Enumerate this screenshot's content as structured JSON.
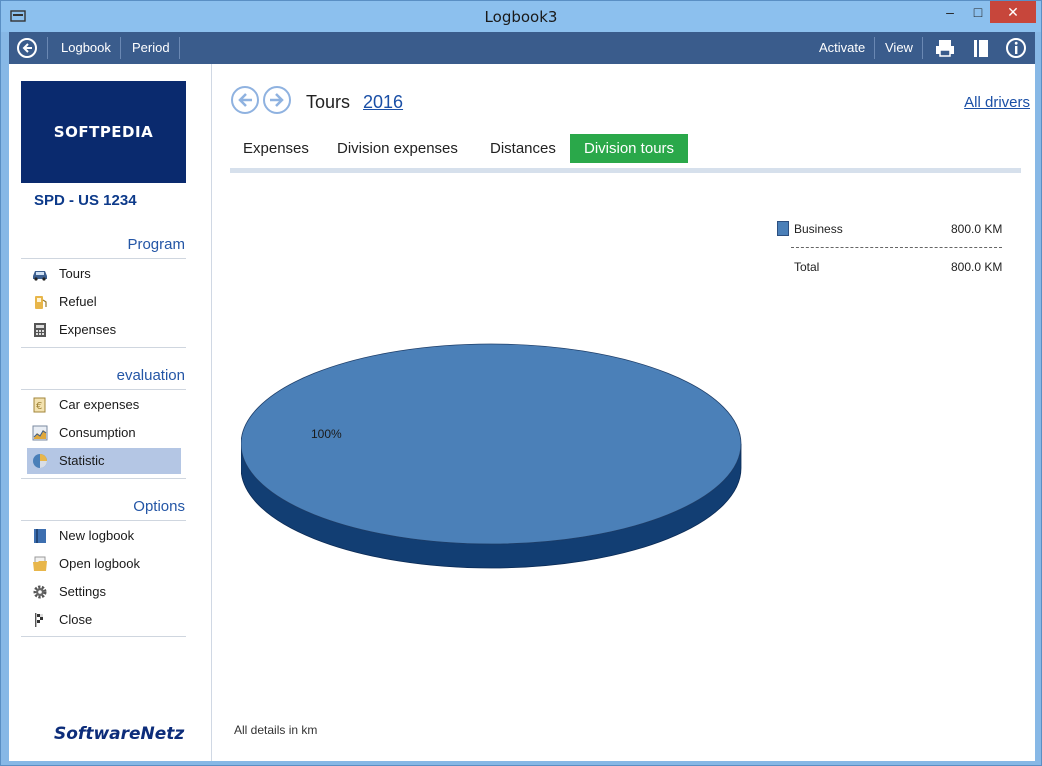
{
  "window": {
    "title": "Logbook3"
  },
  "toolbar": {
    "logbook": "Logbook",
    "period": "Period",
    "activate": "Activate",
    "view": "View"
  },
  "sidebar": {
    "logo": "SOFTPEDIA",
    "vehicle": "SPD - US 1234",
    "program_title": "Program",
    "program_items": [
      {
        "label": "Tours",
        "icon": "car-icon"
      },
      {
        "label": "Refuel",
        "icon": "fuel-icon"
      },
      {
        "label": "Expenses",
        "icon": "calculator-icon"
      }
    ],
    "evaluation_title": "evaluation",
    "evaluation_items": [
      {
        "label": "Car expenses",
        "icon": "car-expenses-icon"
      },
      {
        "label": "Consumption",
        "icon": "consumption-chart-icon"
      },
      {
        "label": "Statistic",
        "icon": "pie-chart-icon",
        "active": true
      }
    ],
    "options_title": "Options",
    "options_items": [
      {
        "label": "New logbook",
        "icon": "book-icon"
      },
      {
        "label": "Open logbook",
        "icon": "folder-icon"
      },
      {
        "label": "Settings",
        "icon": "gear-icon"
      },
      {
        "label": "Close",
        "icon": "flag-icon"
      }
    ],
    "brand": "SoftwareNetz"
  },
  "main": {
    "title": "Tours",
    "year": "2016",
    "all_drivers": "All drivers",
    "tabs": [
      {
        "label": "Expenses",
        "active": false
      },
      {
        "label": "Division expenses",
        "active": false
      },
      {
        "label": "Distances",
        "active": false
      },
      {
        "label": "Division tours",
        "active": true
      }
    ],
    "legend": {
      "business_label": "Business",
      "business_value": "800.0 KM",
      "total_label": "Total",
      "total_value": "800.0 KM"
    },
    "footnote": "All details in km"
  },
  "chart_data": {
    "type": "pie",
    "categories": [
      "Business"
    ],
    "values": [
      800.0
    ],
    "slice_labels": [
      "100%"
    ],
    "colors": {
      "slice": "#4b80b8",
      "side": "#123e73"
    },
    "legend_placement": "top-right"
  },
  "colors": {
    "toolbar": "#3a5c8c",
    "accent_tab": "#2aa84a",
    "link": "#1a4fa6",
    "logo_bg": "#0a2a6e"
  }
}
